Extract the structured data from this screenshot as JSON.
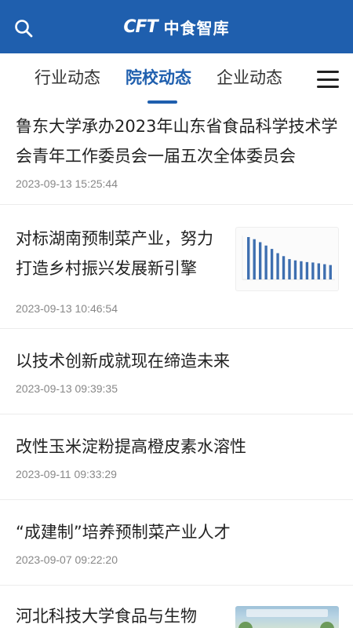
{
  "header": {
    "logo_mark": "CFT",
    "logo_text": "中食智库",
    "brand_color": "#1f5fae",
    "search_icon": "search-icon"
  },
  "tabs": [
    {
      "label": "行业动态",
      "active": false
    },
    {
      "label": "院校动态",
      "active": true
    },
    {
      "label": "企业动态",
      "active": false
    }
  ],
  "menu_icon": "hamburger-menu-icon",
  "news": [
    {
      "title": "鲁东大学承办2023年山东省食品科学技术学会青年工作委员会一届五次全体委员会",
      "date": "2023-09-13 15:25:44",
      "thumbnail": null
    },
    {
      "title": "对标湖南预制菜产业，努力打造乡村振兴发展新引擎",
      "date": "2023-09-13 10:46:54",
      "thumbnail": "bar-chart-thumbnail"
    },
    {
      "title": "以技术创新成就现在缔造未来",
      "date": "2023-09-13 09:39:35",
      "thumbnail": null
    },
    {
      "title": "改性玉米淀粉提高橙皮素水溶性",
      "date": "2023-09-11 09:33:29",
      "thumbnail": null
    },
    {
      "title": "“成建制”培养预制菜产业人才",
      "date": "2023-09-07 09:22:20",
      "thumbnail": null
    },
    {
      "title": "河北科技大学食品与生物",
      "date": "",
      "thumbnail": "campus-photo-thumbnail"
    }
  ],
  "thumbnail_chart": {
    "values": [
      100,
      95,
      88,
      80,
      72,
      62,
      55,
      48,
      45,
      43,
      41,
      40,
      38,
      36,
      34
    ],
    "bar_color": "#3e6fb0"
  }
}
